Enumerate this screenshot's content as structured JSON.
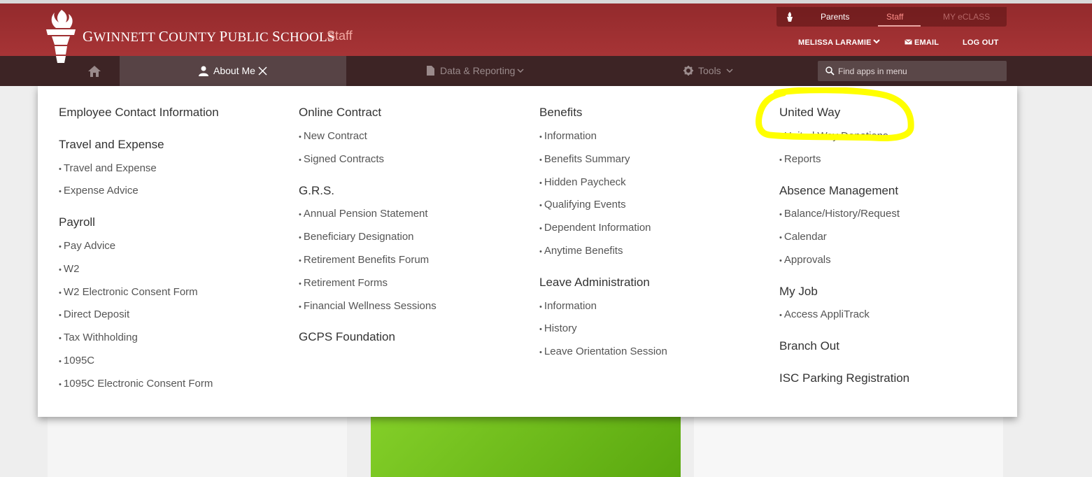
{
  "header": {
    "brand_big1": "G",
    "brand_small1": "WINNETT ",
    "brand_big2": "C",
    "brand_small2": "OUNTY ",
    "brand_big3": "P",
    "brand_small3": "UBLIC ",
    "brand_big4": "S",
    "brand_small4": "CHOOLS",
    "staff_label": "Staff",
    "switcher": {
      "parents": "Parents",
      "staff": "Staff",
      "my_eclass": "MY eCLASS"
    },
    "user_name": "MELISSA LARAMIE",
    "email_label": "EMAIL",
    "logout_label": "LOG OUT"
  },
  "nav": {
    "about_me": "About Me",
    "data_reporting": "Data & Reporting",
    "tools": "Tools",
    "search_placeholder": "Find apps in menu"
  },
  "menu": {
    "col1": {
      "employee_contact": "Employee Contact Information",
      "travel_heading": "Travel and Expense",
      "travel_items": [
        "Travel and Expense",
        "Expense Advice"
      ],
      "payroll_heading": "Payroll",
      "payroll_items": [
        "Pay Advice",
        "W2",
        "W2 Electronic Consent Form",
        "Direct Deposit",
        "Tax Withholding",
        "1095C",
        "1095C Electronic Consent Form"
      ]
    },
    "col2": {
      "online_contract_heading": "Online Contract",
      "online_contract_items": [
        "New Contract",
        "Signed Contracts"
      ],
      "grs_heading": "G.R.S.",
      "grs_items": [
        "Annual Pension Statement",
        "Beneficiary Designation",
        "Retirement Benefits Forum",
        "Retirement Forms",
        "Financial Wellness Sessions"
      ],
      "foundation_heading": "GCPS Foundation"
    },
    "col3": {
      "benefits_heading": "Benefits",
      "benefits_items": [
        "Information",
        "Benefits Summary",
        "Hidden Paycheck",
        "Qualifying Events",
        "Dependent Information",
        "Anytime Benefits"
      ],
      "leave_heading": "Leave Administration",
      "leave_items": [
        "Information",
        "History",
        "Leave Orientation Session"
      ]
    },
    "col4": {
      "united_way_heading": "United Way",
      "united_way_items": [
        "United Way Donations",
        "Reports"
      ],
      "absence_heading": "Absence Management",
      "absence_items": [
        "Balance/History/Request",
        "Calendar",
        "Approvals"
      ],
      "my_job_heading": "My Job",
      "my_job_items": [
        "Access AppliTrack"
      ],
      "branch_out_heading": "Branch Out",
      "isc_heading": "ISC Parking Registration"
    }
  },
  "colors": {
    "header_red": "#a73436",
    "nav_dark": "#3d2425",
    "nav_active": "#574345",
    "highlight_yellow": "#ffff00"
  }
}
